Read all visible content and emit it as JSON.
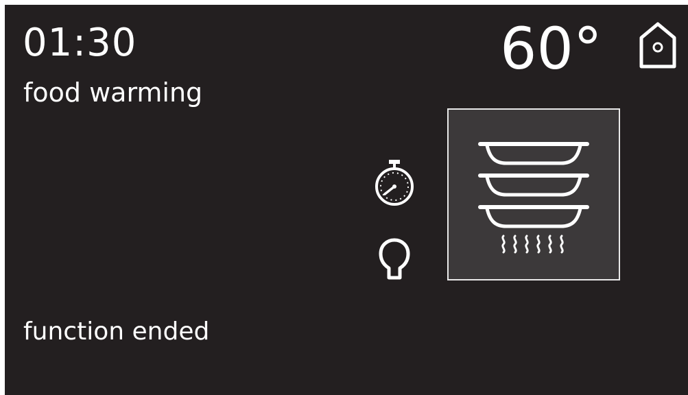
{
  "display": {
    "time": "01:30",
    "function_name": "food warming",
    "temperature": "60°",
    "status": "function ended"
  },
  "icons": {
    "home": "home-icon",
    "timer": "timer-icon",
    "light": "light-bulb-icon",
    "mode": "food-warming-dishes-icon"
  },
  "colors": {
    "background": "#231f20",
    "text": "#ffffff",
    "tile_background": "#3c393a"
  }
}
